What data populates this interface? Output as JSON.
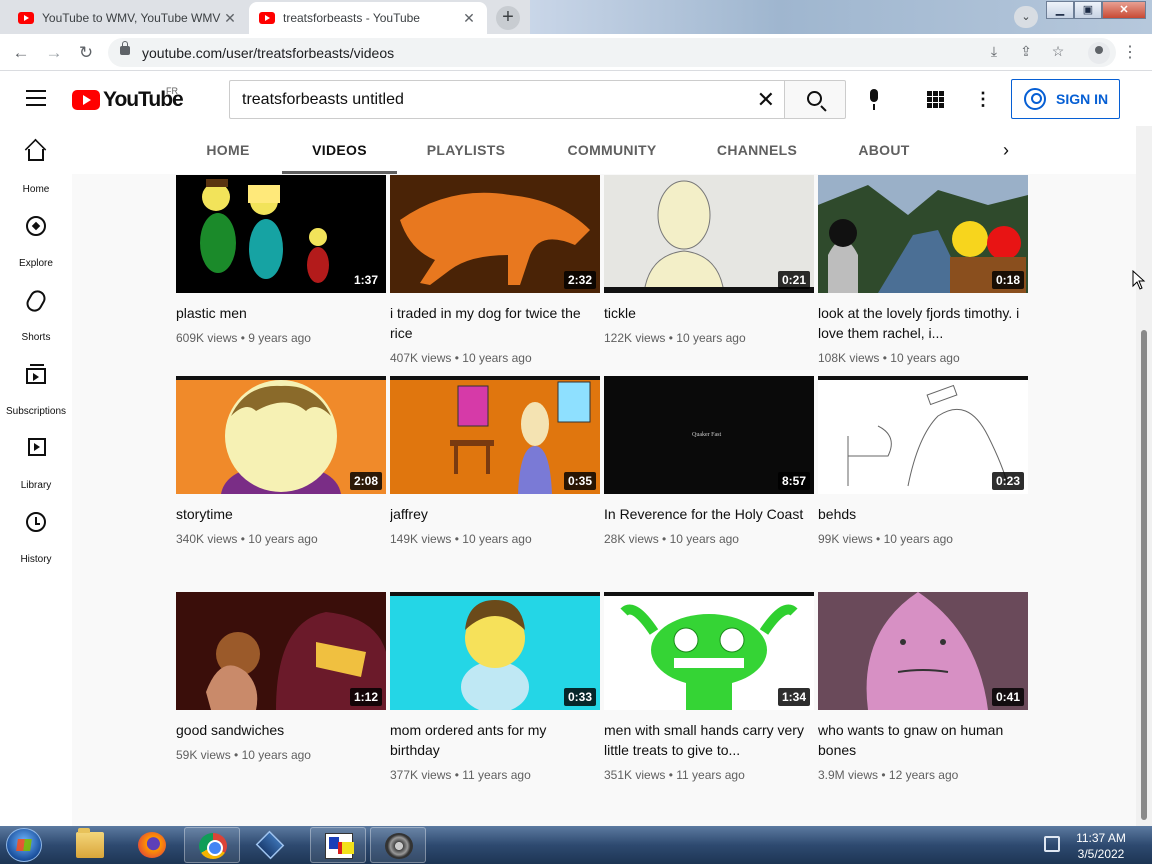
{
  "browser": {
    "tabs": [
      {
        "title": "YouTube to WMV, YouTube WMV",
        "active": false
      },
      {
        "title": "treatsforbeasts - YouTube",
        "active": true
      }
    ],
    "url": "youtube.com/user/treatsforbeasts/videos"
  },
  "masthead": {
    "logo_text": "YouTube",
    "country_code": "FR",
    "search_query": "treatsforbeasts untitled",
    "sign_in_label": "SIGN IN"
  },
  "guide": [
    {
      "label": "Home",
      "icon": "home-icon"
    },
    {
      "label": "Explore",
      "icon": "compass-icon"
    },
    {
      "label": "Shorts",
      "icon": "shorts-icon"
    },
    {
      "label": "Subscriptions",
      "icon": "subscriptions-icon"
    },
    {
      "label": "Library",
      "icon": "library-icon"
    },
    {
      "label": "History",
      "icon": "history-icon"
    }
  ],
  "channel_tabs": [
    {
      "label": "HOME",
      "active": false
    },
    {
      "label": "VIDEOS",
      "active": true
    },
    {
      "label": "PLAYLISTS",
      "active": false
    },
    {
      "label": "COMMUNITY",
      "active": false
    },
    {
      "label": "CHANNELS",
      "active": false
    },
    {
      "label": "ABOUT",
      "active": false
    }
  ],
  "videos": [
    {
      "title": "plastic men",
      "duration": "1:37",
      "views": "609K views",
      "age": "9 years ago"
    },
    {
      "title": "i traded in my dog for twice the rice",
      "duration": "2:32",
      "views": "407K views",
      "age": "10 years ago"
    },
    {
      "title": "tickle",
      "duration": "0:21",
      "views": "122K views",
      "age": "10 years ago"
    },
    {
      "title": "look at the lovely fjords timothy. i love them rachel, i...",
      "duration": "0:18",
      "views": "108K views",
      "age": "10 years ago"
    },
    {
      "title": "storytime",
      "duration": "2:08",
      "views": "340K views",
      "age": "10 years ago"
    },
    {
      "title": "jaffrey",
      "duration": "0:35",
      "views": "149K views",
      "age": "10 years ago"
    },
    {
      "title": "In Reverence for the Holy Coast",
      "duration": "8:57",
      "views": "28K views",
      "age": "10 years ago",
      "thumb_text": "Quaker Fast"
    },
    {
      "title": "behds",
      "duration": "0:23",
      "views": "99K views",
      "age": "10 years ago"
    },
    {
      "title": "good sandwiches",
      "duration": "1:12",
      "views": "59K views",
      "age": "10 years ago"
    },
    {
      "title": "mom ordered ants for my birthday",
      "duration": "0:33",
      "views": "377K views",
      "age": "11 years ago"
    },
    {
      "title": "men with small hands carry very little treats to give to...",
      "duration": "1:34",
      "views": "351K views",
      "age": "11 years ago"
    },
    {
      "title": "who wants to gnaw on human bones",
      "duration": "0:41",
      "views": "3.9M views",
      "age": "12 years ago"
    }
  ],
  "meta_separator": "•",
  "taskbar": {
    "time": "11:37 AM",
    "date": "3/5/2022"
  }
}
